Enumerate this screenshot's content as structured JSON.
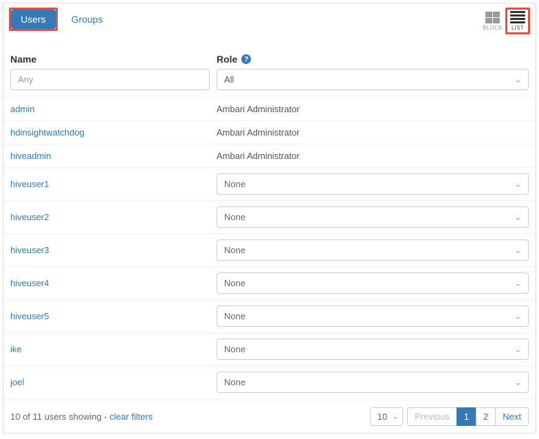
{
  "tabs": {
    "users": "Users",
    "groups": "Groups",
    "active": "users"
  },
  "viewToggle": {
    "block": "BLOCK",
    "list": "LIST",
    "active": "list"
  },
  "columns": {
    "name": "Name",
    "role": "Role"
  },
  "filters": {
    "namePlaceholder": "Any",
    "roleValue": "All"
  },
  "roleOptionNone": "None",
  "rows": [
    {
      "name": "admin",
      "role": "Ambari Administrator",
      "editable": false
    },
    {
      "name": "hdinsightwatchdog",
      "role": "Ambari Administrator",
      "editable": false
    },
    {
      "name": "hiveadmin",
      "role": "Ambari Administrator",
      "editable": false
    },
    {
      "name": "hiveuser1",
      "role": "None",
      "editable": true
    },
    {
      "name": "hiveuser2",
      "role": "None",
      "editable": true
    },
    {
      "name": "hiveuser3",
      "role": "None",
      "editable": true
    },
    {
      "name": "hiveuser4",
      "role": "None",
      "editable": true
    },
    {
      "name": "hiveuser5",
      "role": "None",
      "editable": true
    },
    {
      "name": "ike",
      "role": "None",
      "editable": true
    },
    {
      "name": "joel",
      "role": "None",
      "editable": true
    }
  ],
  "footer": {
    "showingText": "10 of 11 users showing - ",
    "clearFilters": "clear filters",
    "pageSize": "10",
    "previous": "Previous",
    "next": "Next",
    "pages": [
      "1",
      "2"
    ],
    "activePage": "1"
  }
}
